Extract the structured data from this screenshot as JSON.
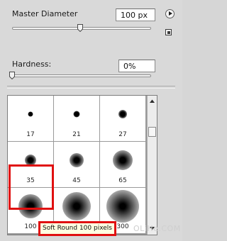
{
  "master_diameter": {
    "label": "Master Diameter",
    "value": "100 px",
    "slider_level_fraction": 0.45
  },
  "hardness": {
    "label": "Hardness:",
    "value": "0%",
    "slider_level_fraction": 0.0
  },
  "icons": {
    "flyout": "flyout-menu-arrow-icon",
    "resize": "create-preset-icon"
  },
  "brushes": [
    {
      "size": "17"
    },
    {
      "size": "21"
    },
    {
      "size": "27"
    },
    {
      "size": "35"
    },
    {
      "size": "45"
    },
    {
      "size": "65"
    },
    {
      "size": "100"
    },
    {
      "size": ""
    },
    {
      "size": "300"
    }
  ],
  "tooltip": "Soft Round 100 pixels",
  "watermark": "OLiHe.COM",
  "colors": {
    "highlight": "#e01010",
    "tooltip_bg": "#ffffe1"
  }
}
